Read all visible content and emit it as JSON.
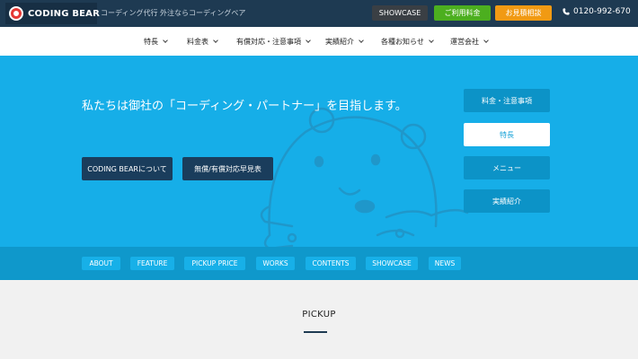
{
  "topbar": {
    "logo": "CODING BEAR",
    "tagline": "コーディング代行 外注ならコーディングベア",
    "showcase": "SHOWCASE",
    "price": "ご利用料金",
    "estimate": "お見積相談",
    "phone": "0120-992-670",
    "colors": {
      "price": "#4caf1f",
      "estimate": "#f19a13"
    }
  },
  "nav": {
    "items": [
      {
        "label": "特長"
      },
      {
        "label": "料金表"
      },
      {
        "label": "有償対応・注意事項"
      },
      {
        "label": "実績紹介"
      },
      {
        "label": "各種お知らせ"
      },
      {
        "label": "運営会社"
      }
    ]
  },
  "hero": {
    "title": "私たちは御社の「コーディング・パートナー」を目指します。",
    "about_button": "CODING BEARについて",
    "list_button": "無償/有償対応早見表",
    "side_menu": [
      {
        "label": "料金・注意事項"
      },
      {
        "label": "特長"
      },
      {
        "label": "メニュー"
      },
      {
        "label": "実績紹介"
      }
    ],
    "colors": {
      "background": "#16aee8"
    }
  },
  "anchors": [
    {
      "label": "ABOUT"
    },
    {
      "label": "FEATURE"
    },
    {
      "label": "PICKUP PRICE"
    },
    {
      "label": "WORKS"
    },
    {
      "label": "CONTENTS"
    },
    {
      "label": "SHOWCASE"
    },
    {
      "label": "NEWS"
    }
  ],
  "pickup": {
    "title": "PICKUP"
  }
}
